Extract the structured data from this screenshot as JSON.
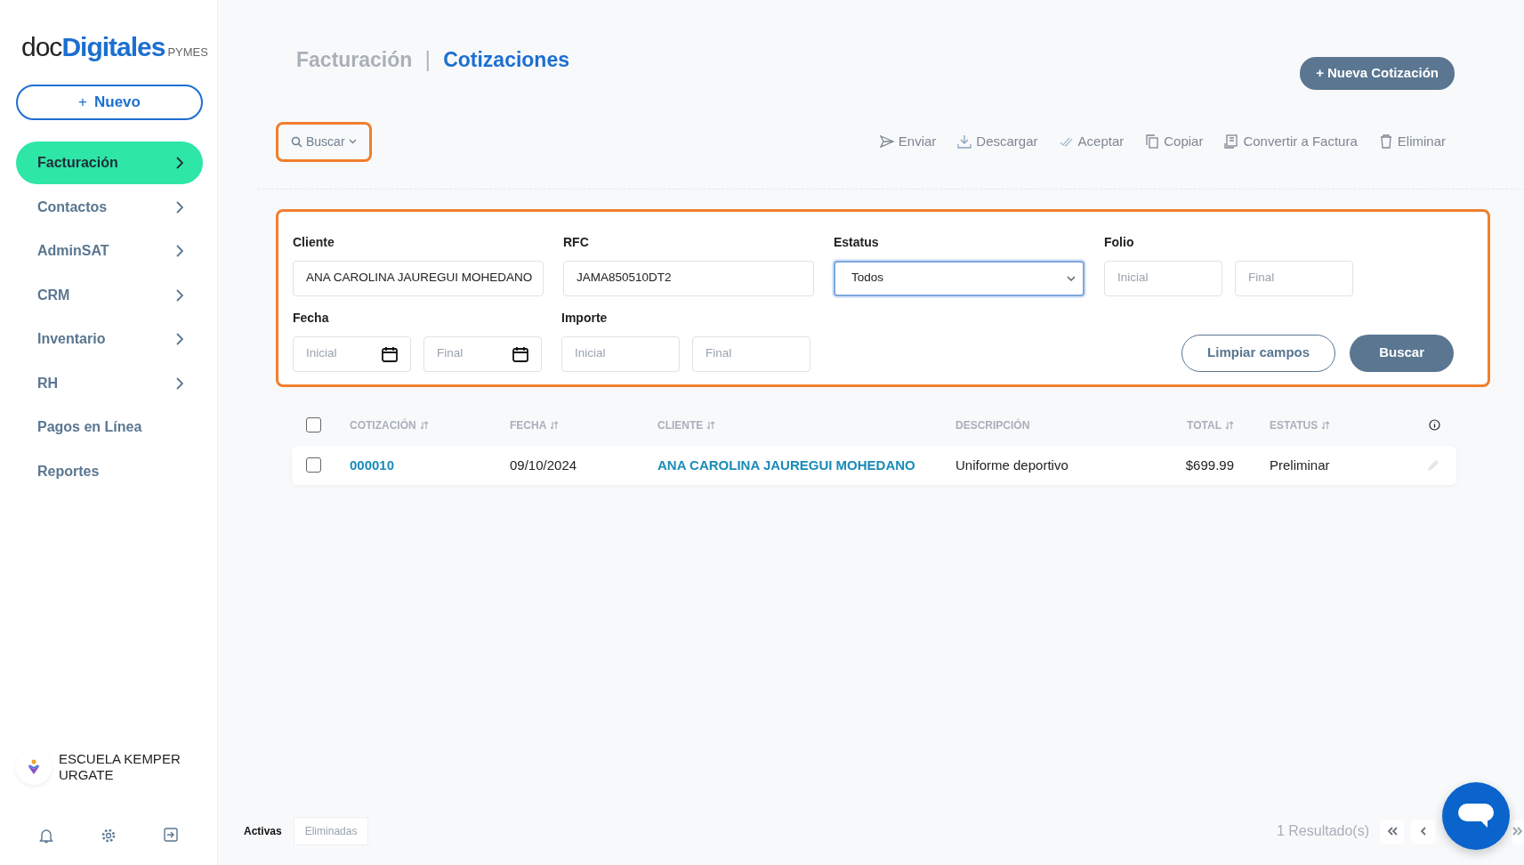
{
  "logo": {
    "prefix": "doc",
    "brand": "Digitales",
    "suffix": "PYMES"
  },
  "new_button": {
    "icon": "+",
    "label": "Nuevo"
  },
  "sidebar": {
    "items": [
      {
        "label": "Facturación",
        "selected": true,
        "has_arrow": true
      },
      {
        "label": "Contactos",
        "selected": false,
        "has_arrow": true
      },
      {
        "label": "AdminSAT",
        "selected": false,
        "has_arrow": true
      },
      {
        "label": "CRM",
        "selected": false,
        "has_arrow": true
      },
      {
        "label": "Inventario",
        "selected": false,
        "has_arrow": true
      },
      {
        "label": "RH",
        "selected": false,
        "has_arrow": true
      },
      {
        "label": "Pagos en Línea",
        "selected": false,
        "has_arrow": false
      },
      {
        "label": "Reportes",
        "selected": false,
        "has_arrow": false
      }
    ],
    "company": "ESCUELA KEMPER URGATE"
  },
  "title": {
    "section": "Facturación",
    "separator": "|",
    "page": "Cotizaciones"
  },
  "primary_action": {
    "icon": "+",
    "label": "Nueva Cotización"
  },
  "search_toggle": {
    "label": "Buscar",
    "highlighted": true
  },
  "actions": [
    {
      "label": "Enviar",
      "kind": "send"
    },
    {
      "label": "Descargar",
      "kind": "download"
    },
    {
      "label": "Aceptar",
      "kind": "check"
    },
    {
      "label": "Copiar",
      "kind": "copy"
    },
    {
      "label": "Convertir a Factura",
      "kind": "doc"
    },
    {
      "label": "Eliminar",
      "kind": "trash"
    }
  ],
  "filters": {
    "highlighted": true,
    "rows": [
      {
        "fields": [
          {
            "label": "Cliente",
            "kind": "text",
            "inputs": [
              {
                "value": "ANA CAROLINA JAUREGUI MOHEDANO"
              }
            ]
          },
          {
            "label": "RFC",
            "kind": "text",
            "inputs": [
              {
                "value": "JAMA850510DT2"
              }
            ]
          },
          {
            "label": "Estatus",
            "kind": "select",
            "inputs": [
              {
                "value": "Todos",
                "focused": true
              }
            ]
          },
          {
            "label": "Folio",
            "kind": "range",
            "inputs": [
              {
                "placeholder": "Inicial"
              },
              {
                "placeholder": "Final"
              }
            ]
          }
        ]
      },
      {
        "fields": [
          {
            "label": "Fecha",
            "kind": "date",
            "inputs": [
              {
                "placeholder": "Inicial"
              },
              {
                "placeholder": "Final"
              }
            ]
          },
          {
            "label": "Importe",
            "kind": "range",
            "inputs": [
              {
                "placeholder": "Inicial"
              },
              {
                "placeholder": "Final"
              }
            ]
          }
        ]
      }
    ],
    "buttons": [
      {
        "label": "Limpiar campos",
        "kind": "outline"
      },
      {
        "label": "Buscar",
        "kind": "solid"
      }
    ]
  },
  "table": {
    "select_all": {
      "checked": false
    },
    "columns": [
      {
        "label": "COTIZACIÓN",
        "sortable": true
      },
      {
        "label": "FECHA",
        "sortable": true
      },
      {
        "label": "CLIENTE",
        "sortable": true
      },
      {
        "label": "DESCRIPCIÓN",
        "sortable": false
      },
      {
        "label": "TOTAL",
        "sortable": true
      },
      {
        "label": "ESTATUS",
        "sortable": true
      }
    ],
    "rows": [
      {
        "checked": false,
        "cells": [
          {
            "text": "000010",
            "kind": "link"
          },
          {
            "text": "09/10/2024",
            "kind": "text"
          },
          {
            "text": "ANA CAROLINA JAUREGUI MOHEDANO",
            "kind": "link"
          },
          {
            "text": "Uniforme deportivo",
            "kind": "text"
          },
          {
            "text": "$699.99",
            "kind": "number"
          },
          {
            "text": "Preliminar",
            "kind": "text"
          }
        ]
      }
    ]
  },
  "tabs": [
    {
      "label": "Activas",
      "selected": true
    },
    {
      "label": "Eliminadas",
      "selected": false
    }
  ],
  "results": "1 Resultado(s)"
}
